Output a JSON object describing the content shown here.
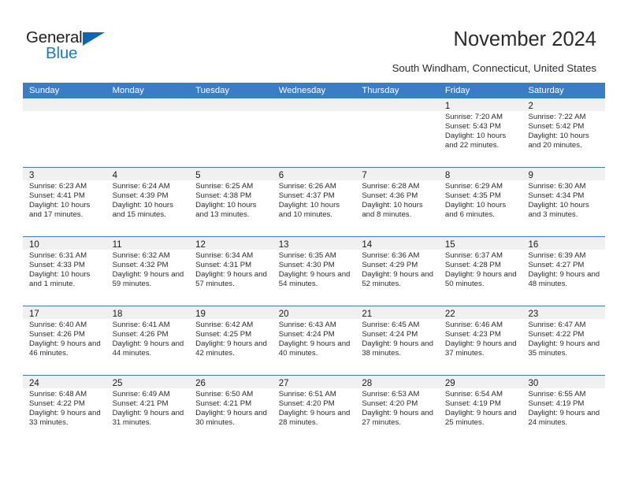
{
  "brand": {
    "name_part1": "General",
    "name_part2": "Blue",
    "triangle_color": "#0b67b2",
    "blue_color": "#1f78c1"
  },
  "header": {
    "title": "November 2024",
    "subtitle": "South Windham, Connecticut, United States"
  },
  "theme": {
    "header_blue": "#3b7dc4",
    "day_band_gray": "#f0f0f0",
    "text": "#2b2b2b"
  },
  "calendar": {
    "weekdays": [
      "Sunday",
      "Monday",
      "Tuesday",
      "Wednesday",
      "Thursday",
      "Friday",
      "Saturday"
    ],
    "weeks": [
      [
        {
          "day": "",
          "empty": true,
          "lines": []
        },
        {
          "day": "",
          "empty": true,
          "lines": []
        },
        {
          "day": "",
          "empty": true,
          "lines": []
        },
        {
          "day": "",
          "empty": true,
          "lines": []
        },
        {
          "day": "",
          "empty": true,
          "lines": []
        },
        {
          "day": "1",
          "empty": false,
          "lines": [
            "Sunrise: 7:20 AM",
            "Sunset: 5:43 PM",
            "Daylight: 10 hours and 22 minutes."
          ]
        },
        {
          "day": "2",
          "empty": false,
          "lines": [
            "Sunrise: 7:22 AM",
            "Sunset: 5:42 PM",
            "Daylight: 10 hours and 20 minutes."
          ]
        }
      ],
      [
        {
          "day": "3",
          "empty": false,
          "lines": [
            "Sunrise: 6:23 AM",
            "Sunset: 4:41 PM",
            "Daylight: 10 hours and 17 minutes."
          ]
        },
        {
          "day": "4",
          "empty": false,
          "lines": [
            "Sunrise: 6:24 AM",
            "Sunset: 4:39 PM",
            "Daylight: 10 hours and 15 minutes."
          ]
        },
        {
          "day": "5",
          "empty": false,
          "lines": [
            "Sunrise: 6:25 AM",
            "Sunset: 4:38 PM",
            "Daylight: 10 hours and 13 minutes."
          ]
        },
        {
          "day": "6",
          "empty": false,
          "lines": [
            "Sunrise: 6:26 AM",
            "Sunset: 4:37 PM",
            "Daylight: 10 hours and 10 minutes."
          ]
        },
        {
          "day": "7",
          "empty": false,
          "lines": [
            "Sunrise: 6:28 AM",
            "Sunset: 4:36 PM",
            "Daylight: 10 hours and 8 minutes."
          ]
        },
        {
          "day": "8",
          "empty": false,
          "lines": [
            "Sunrise: 6:29 AM",
            "Sunset: 4:35 PM",
            "Daylight: 10 hours and 6 minutes."
          ]
        },
        {
          "day": "9",
          "empty": false,
          "lines": [
            "Sunrise: 6:30 AM",
            "Sunset: 4:34 PM",
            "Daylight: 10 hours and 3 minutes."
          ]
        }
      ],
      [
        {
          "day": "10",
          "empty": false,
          "lines": [
            "Sunrise: 6:31 AM",
            "Sunset: 4:33 PM",
            "Daylight: 10 hours and 1 minute."
          ]
        },
        {
          "day": "11",
          "empty": false,
          "lines": [
            "Sunrise: 6:32 AM",
            "Sunset: 4:32 PM",
            "Daylight: 9 hours and 59 minutes."
          ]
        },
        {
          "day": "12",
          "empty": false,
          "lines": [
            "Sunrise: 6:34 AM",
            "Sunset: 4:31 PM",
            "Daylight: 9 hours and 57 minutes."
          ]
        },
        {
          "day": "13",
          "empty": false,
          "lines": [
            "Sunrise: 6:35 AM",
            "Sunset: 4:30 PM",
            "Daylight: 9 hours and 54 minutes."
          ]
        },
        {
          "day": "14",
          "empty": false,
          "lines": [
            "Sunrise: 6:36 AM",
            "Sunset: 4:29 PM",
            "Daylight: 9 hours and 52 minutes."
          ]
        },
        {
          "day": "15",
          "empty": false,
          "lines": [
            "Sunrise: 6:37 AM",
            "Sunset: 4:28 PM",
            "Daylight: 9 hours and 50 minutes."
          ]
        },
        {
          "day": "16",
          "empty": false,
          "lines": [
            "Sunrise: 6:39 AM",
            "Sunset: 4:27 PM",
            "Daylight: 9 hours and 48 minutes."
          ]
        }
      ],
      [
        {
          "day": "17",
          "empty": false,
          "lines": [
            "Sunrise: 6:40 AM",
            "Sunset: 4:26 PM",
            "Daylight: 9 hours and 46 minutes."
          ]
        },
        {
          "day": "18",
          "empty": false,
          "lines": [
            "Sunrise: 6:41 AM",
            "Sunset: 4:26 PM",
            "Daylight: 9 hours and 44 minutes."
          ]
        },
        {
          "day": "19",
          "empty": false,
          "lines": [
            "Sunrise: 6:42 AM",
            "Sunset: 4:25 PM",
            "Daylight: 9 hours and 42 minutes."
          ]
        },
        {
          "day": "20",
          "empty": false,
          "lines": [
            "Sunrise: 6:43 AM",
            "Sunset: 4:24 PM",
            "Daylight: 9 hours and 40 minutes."
          ]
        },
        {
          "day": "21",
          "empty": false,
          "lines": [
            "Sunrise: 6:45 AM",
            "Sunset: 4:24 PM",
            "Daylight: 9 hours and 38 minutes."
          ]
        },
        {
          "day": "22",
          "empty": false,
          "lines": [
            "Sunrise: 6:46 AM",
            "Sunset: 4:23 PM",
            "Daylight: 9 hours and 37 minutes."
          ]
        },
        {
          "day": "23",
          "empty": false,
          "lines": [
            "Sunrise: 6:47 AM",
            "Sunset: 4:22 PM",
            "Daylight: 9 hours and 35 minutes."
          ]
        }
      ],
      [
        {
          "day": "24",
          "empty": false,
          "lines": [
            "Sunrise: 6:48 AM",
            "Sunset: 4:22 PM",
            "Daylight: 9 hours and 33 minutes."
          ]
        },
        {
          "day": "25",
          "empty": false,
          "lines": [
            "Sunrise: 6:49 AM",
            "Sunset: 4:21 PM",
            "Daylight: 9 hours and 31 minutes."
          ]
        },
        {
          "day": "26",
          "empty": false,
          "lines": [
            "Sunrise: 6:50 AM",
            "Sunset: 4:21 PM",
            "Daylight: 9 hours and 30 minutes."
          ]
        },
        {
          "day": "27",
          "empty": false,
          "lines": [
            "Sunrise: 6:51 AM",
            "Sunset: 4:20 PM",
            "Daylight: 9 hours and 28 minutes."
          ]
        },
        {
          "day": "28",
          "empty": false,
          "lines": [
            "Sunrise: 6:53 AM",
            "Sunset: 4:20 PM",
            "Daylight: 9 hours and 27 minutes."
          ]
        },
        {
          "day": "29",
          "empty": false,
          "lines": [
            "Sunrise: 6:54 AM",
            "Sunset: 4:19 PM",
            "Daylight: 9 hours and 25 minutes."
          ]
        },
        {
          "day": "30",
          "empty": false,
          "lines": [
            "Sunrise: 6:55 AM",
            "Sunset: 4:19 PM",
            "Daylight: 9 hours and 24 minutes."
          ]
        }
      ]
    ]
  }
}
